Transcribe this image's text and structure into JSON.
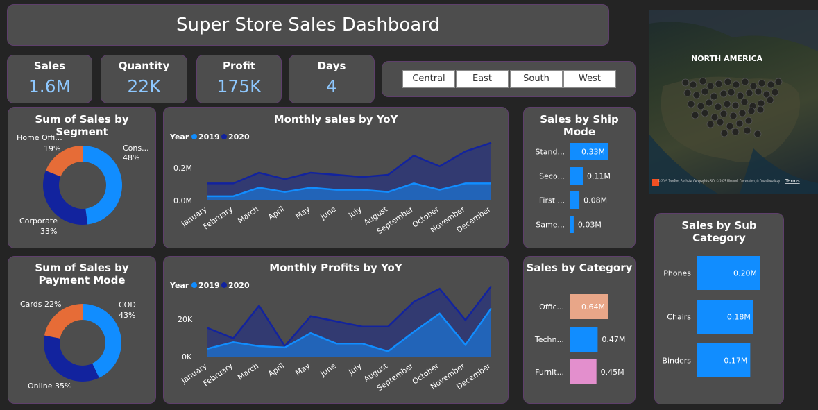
{
  "title": "Super Store Sales Dashboard",
  "kpis": [
    {
      "label": "Sales",
      "value": "1.6M"
    },
    {
      "label": "Quantity",
      "value": "22K"
    },
    {
      "label": "Profit",
      "value": "175K"
    },
    {
      "label": "Days",
      "value": "4"
    }
  ],
  "regions": [
    "Central",
    "East",
    "South",
    "West"
  ],
  "map": {
    "label": "NORTH AMERICA",
    "attribution": "© 2025 TomTom, Earthstar Geographics SIO, © 2025 Microsoft Corporation, © OpenStreetMap",
    "terms": "Terms"
  },
  "colors": {
    "c2019": "#118dff",
    "c2020": "#12239e",
    "orange": "#e66c37",
    "salmon": "#e8a688",
    "pink": "#e38fcd",
    "kpi": "#8ec8ff"
  },
  "legend": {
    "year_label": "Year",
    "y2019": "2019",
    "y2020": "2020"
  },
  "segment": {
    "title": "Sum of Sales by Segment",
    "labels": [
      {
        "name": "Cons...",
        "pct": "48%"
      },
      {
        "name": "Corporate",
        "pct": "33%"
      },
      {
        "name": "Home Offi...",
        "pct": "19%"
      }
    ]
  },
  "payment": {
    "title": "Sum of Sales by Payment Mode",
    "labels": [
      {
        "text": "COD",
        "pct": "43%"
      },
      {
        "text": "Online 35%"
      },
      {
        "text": "Cards 22%"
      }
    ]
  },
  "monthly_sales": {
    "title": "Monthly sales by YoY",
    "yticks": [
      "0.2M",
      "0.0M"
    ]
  },
  "monthly_profits": {
    "title": "Monthly Profits by YoY",
    "yticks": [
      "20K",
      "0K"
    ]
  },
  "months": [
    "January",
    "February",
    "March",
    "April",
    "May",
    "June",
    "July",
    "August",
    "September",
    "October",
    "November",
    "December"
  ],
  "ship_mode": {
    "title": "Sales by Ship Mode",
    "categories": [
      "Stand...",
      "Seco...",
      "First ...",
      "Same..."
    ],
    "labels": [
      "0.33M",
      "0.11M",
      "0.08M",
      "0.03M"
    ]
  },
  "category": {
    "title": "Sales by Category",
    "categories": [
      "Offic...",
      "Techn...",
      "Furnit..."
    ],
    "labels": [
      "0.64M",
      "0.47M",
      "0.45M"
    ]
  },
  "sub_category": {
    "title": "Sales by Sub Category",
    "categories": [
      "Phones",
      "Chairs",
      "Binders"
    ],
    "labels": [
      "0.20M",
      "0.18M",
      "0.17M"
    ]
  },
  "chart_data": [
    {
      "type": "pie",
      "title": "Sum of Sales by Segment",
      "categories": [
        "Consumer",
        "Corporate",
        "Home Office"
      ],
      "values": [
        48,
        33,
        19
      ]
    },
    {
      "type": "pie",
      "title": "Sum of Sales by Payment Mode",
      "categories": [
        "COD",
        "Online",
        "Cards"
      ],
      "values": [
        43,
        35,
        22
      ]
    },
    {
      "type": "area",
      "title": "Monthly sales by YoY",
      "categories": [
        "January",
        "February",
        "March",
        "April",
        "May",
        "June",
        "July",
        "August",
        "September",
        "October",
        "November",
        "December"
      ],
      "ylim": [
        0,
        0.25
      ],
      "series": [
        {
          "name": "2019",
          "values": [
            0.02,
            0.02,
            0.06,
            0.04,
            0.06,
            0.05,
            0.05,
            0.04,
            0.08,
            0.05,
            0.08,
            0.08
          ]
        },
        {
          "name": "2020",
          "values": [
            0.08,
            0.08,
            0.13,
            0.1,
            0.13,
            0.12,
            0.11,
            0.12,
            0.21,
            0.16,
            0.23,
            0.27
          ]
        }
      ]
    },
    {
      "type": "area",
      "title": "Monthly Profits by YoY",
      "categories": [
        "January",
        "February",
        "March",
        "April",
        "May",
        "June",
        "July",
        "August",
        "September",
        "October",
        "November",
        "December"
      ],
      "ylim": [
        0,
        25000
      ],
      "series": [
        {
          "name": "2019",
          "values": [
            3000,
            5500,
            4000,
            3500,
            9000,
            5000,
            5000,
            2000,
            9500,
            16500,
            4500,
            18500
          ]
        },
        {
          "name": "2020",
          "values": [
            11000,
            7000,
            19500,
            4000,
            15500,
            13500,
            11500,
            11500,
            21000,
            26000,
            14000,
            27000
          ]
        }
      ]
    },
    {
      "type": "bar",
      "title": "Sales by Ship Mode",
      "categories": [
        "Stand...",
        "Seco...",
        "First ...",
        "Same..."
      ],
      "values": [
        0.33,
        0.11,
        0.08,
        0.03
      ]
    },
    {
      "type": "bar",
      "title": "Sales by Category",
      "categories": [
        "Offic...",
        "Techn...",
        "Furnit..."
      ],
      "values": [
        0.64,
        0.47,
        0.45
      ]
    },
    {
      "type": "bar",
      "title": "Sales by Sub Category",
      "categories": [
        "Phones",
        "Chairs",
        "Binders"
      ],
      "values": [
        0.2,
        0.18,
        0.17
      ]
    }
  ]
}
